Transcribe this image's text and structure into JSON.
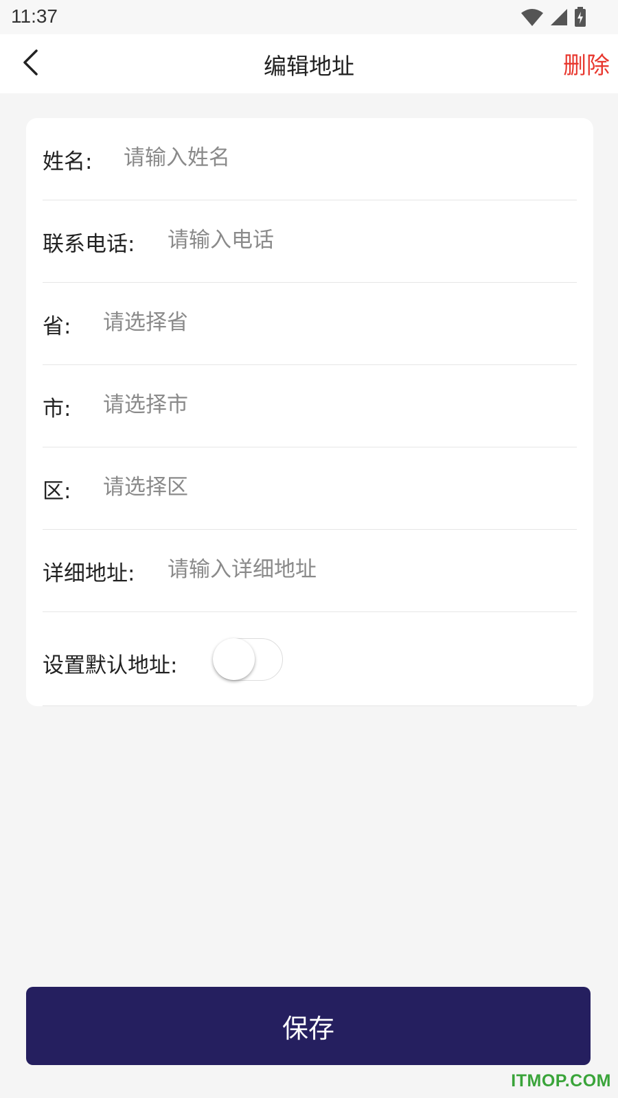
{
  "status_bar": {
    "time": "11:37",
    "icons": [
      "wifi-icon",
      "signal-icon",
      "battery-charging-icon"
    ]
  },
  "nav": {
    "back_icon": "chevron-left-icon",
    "title": "编辑地址",
    "delete_label": "删除"
  },
  "form": {
    "name": {
      "label": "姓名:",
      "placeholder": "请输入姓名",
      "value": ""
    },
    "phone": {
      "label": "联系电话:",
      "placeholder": "请输入电话",
      "value": ""
    },
    "province": {
      "label": "省:",
      "placeholder": "请选择省",
      "value": ""
    },
    "city": {
      "label": "市:",
      "placeholder": "请选择市",
      "value": ""
    },
    "district": {
      "label": "区:",
      "placeholder": "请选择区",
      "value": ""
    },
    "address": {
      "label": "详细地址:",
      "placeholder": "请输入详细地址",
      "value": ""
    },
    "default_address": {
      "label": "设置默认地址:",
      "enabled": false
    }
  },
  "actions": {
    "save_label": "保存"
  },
  "colors": {
    "delete": "#e8382f",
    "save_button": "#251f5f",
    "background": "#f5f5f5",
    "watermark": "#3aa43a"
  },
  "watermark": "ITMOP.COM"
}
